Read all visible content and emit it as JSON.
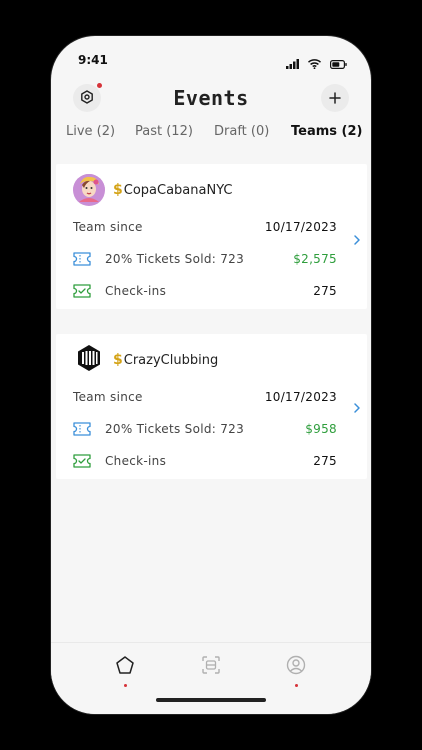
{
  "status_bar": {
    "time": "9:41"
  },
  "header": {
    "title": "Events"
  },
  "tabs": [
    {
      "label": "Live (2)",
      "active": false
    },
    {
      "label": "Past (12)",
      "active": false
    },
    {
      "label": "Draft (0)",
      "active": false
    },
    {
      "label": "Teams (2)",
      "active": true
    }
  ],
  "teams": [
    {
      "currency_symbol": "$",
      "name": "CopaCabanaNYC",
      "avatar_icon": "profile-illustration-avatar",
      "since_label": "Team since",
      "since_date": "10/17/2023",
      "tickets_label": "20% Tickets Sold: 723",
      "tickets_amount": "$2,575",
      "checkins_label": "Check-ins",
      "checkins_value": "275"
    },
    {
      "currency_symbol": "$",
      "name": "CrazyClubbing",
      "avatar_icon": "black-white-logo-avatar",
      "since_label": "Team since",
      "since_date": "10/17/2023",
      "tickets_label": "20% Tickets Sold: 723",
      "tickets_amount": "$958",
      "checkins_label": "Check-ins",
      "checkins_value": "275"
    }
  ],
  "colors": {
    "accent_blue": "#3b8fd9",
    "money_green": "#2f9e3d",
    "dollar_gold": "#d4a317",
    "notification_red": "#d6333a"
  },
  "bottom_nav": [
    {
      "icon": "home-pentagon-icon",
      "active": true
    },
    {
      "icon": "scan-icon",
      "active": false
    },
    {
      "icon": "profile-icon",
      "active": false
    }
  ]
}
